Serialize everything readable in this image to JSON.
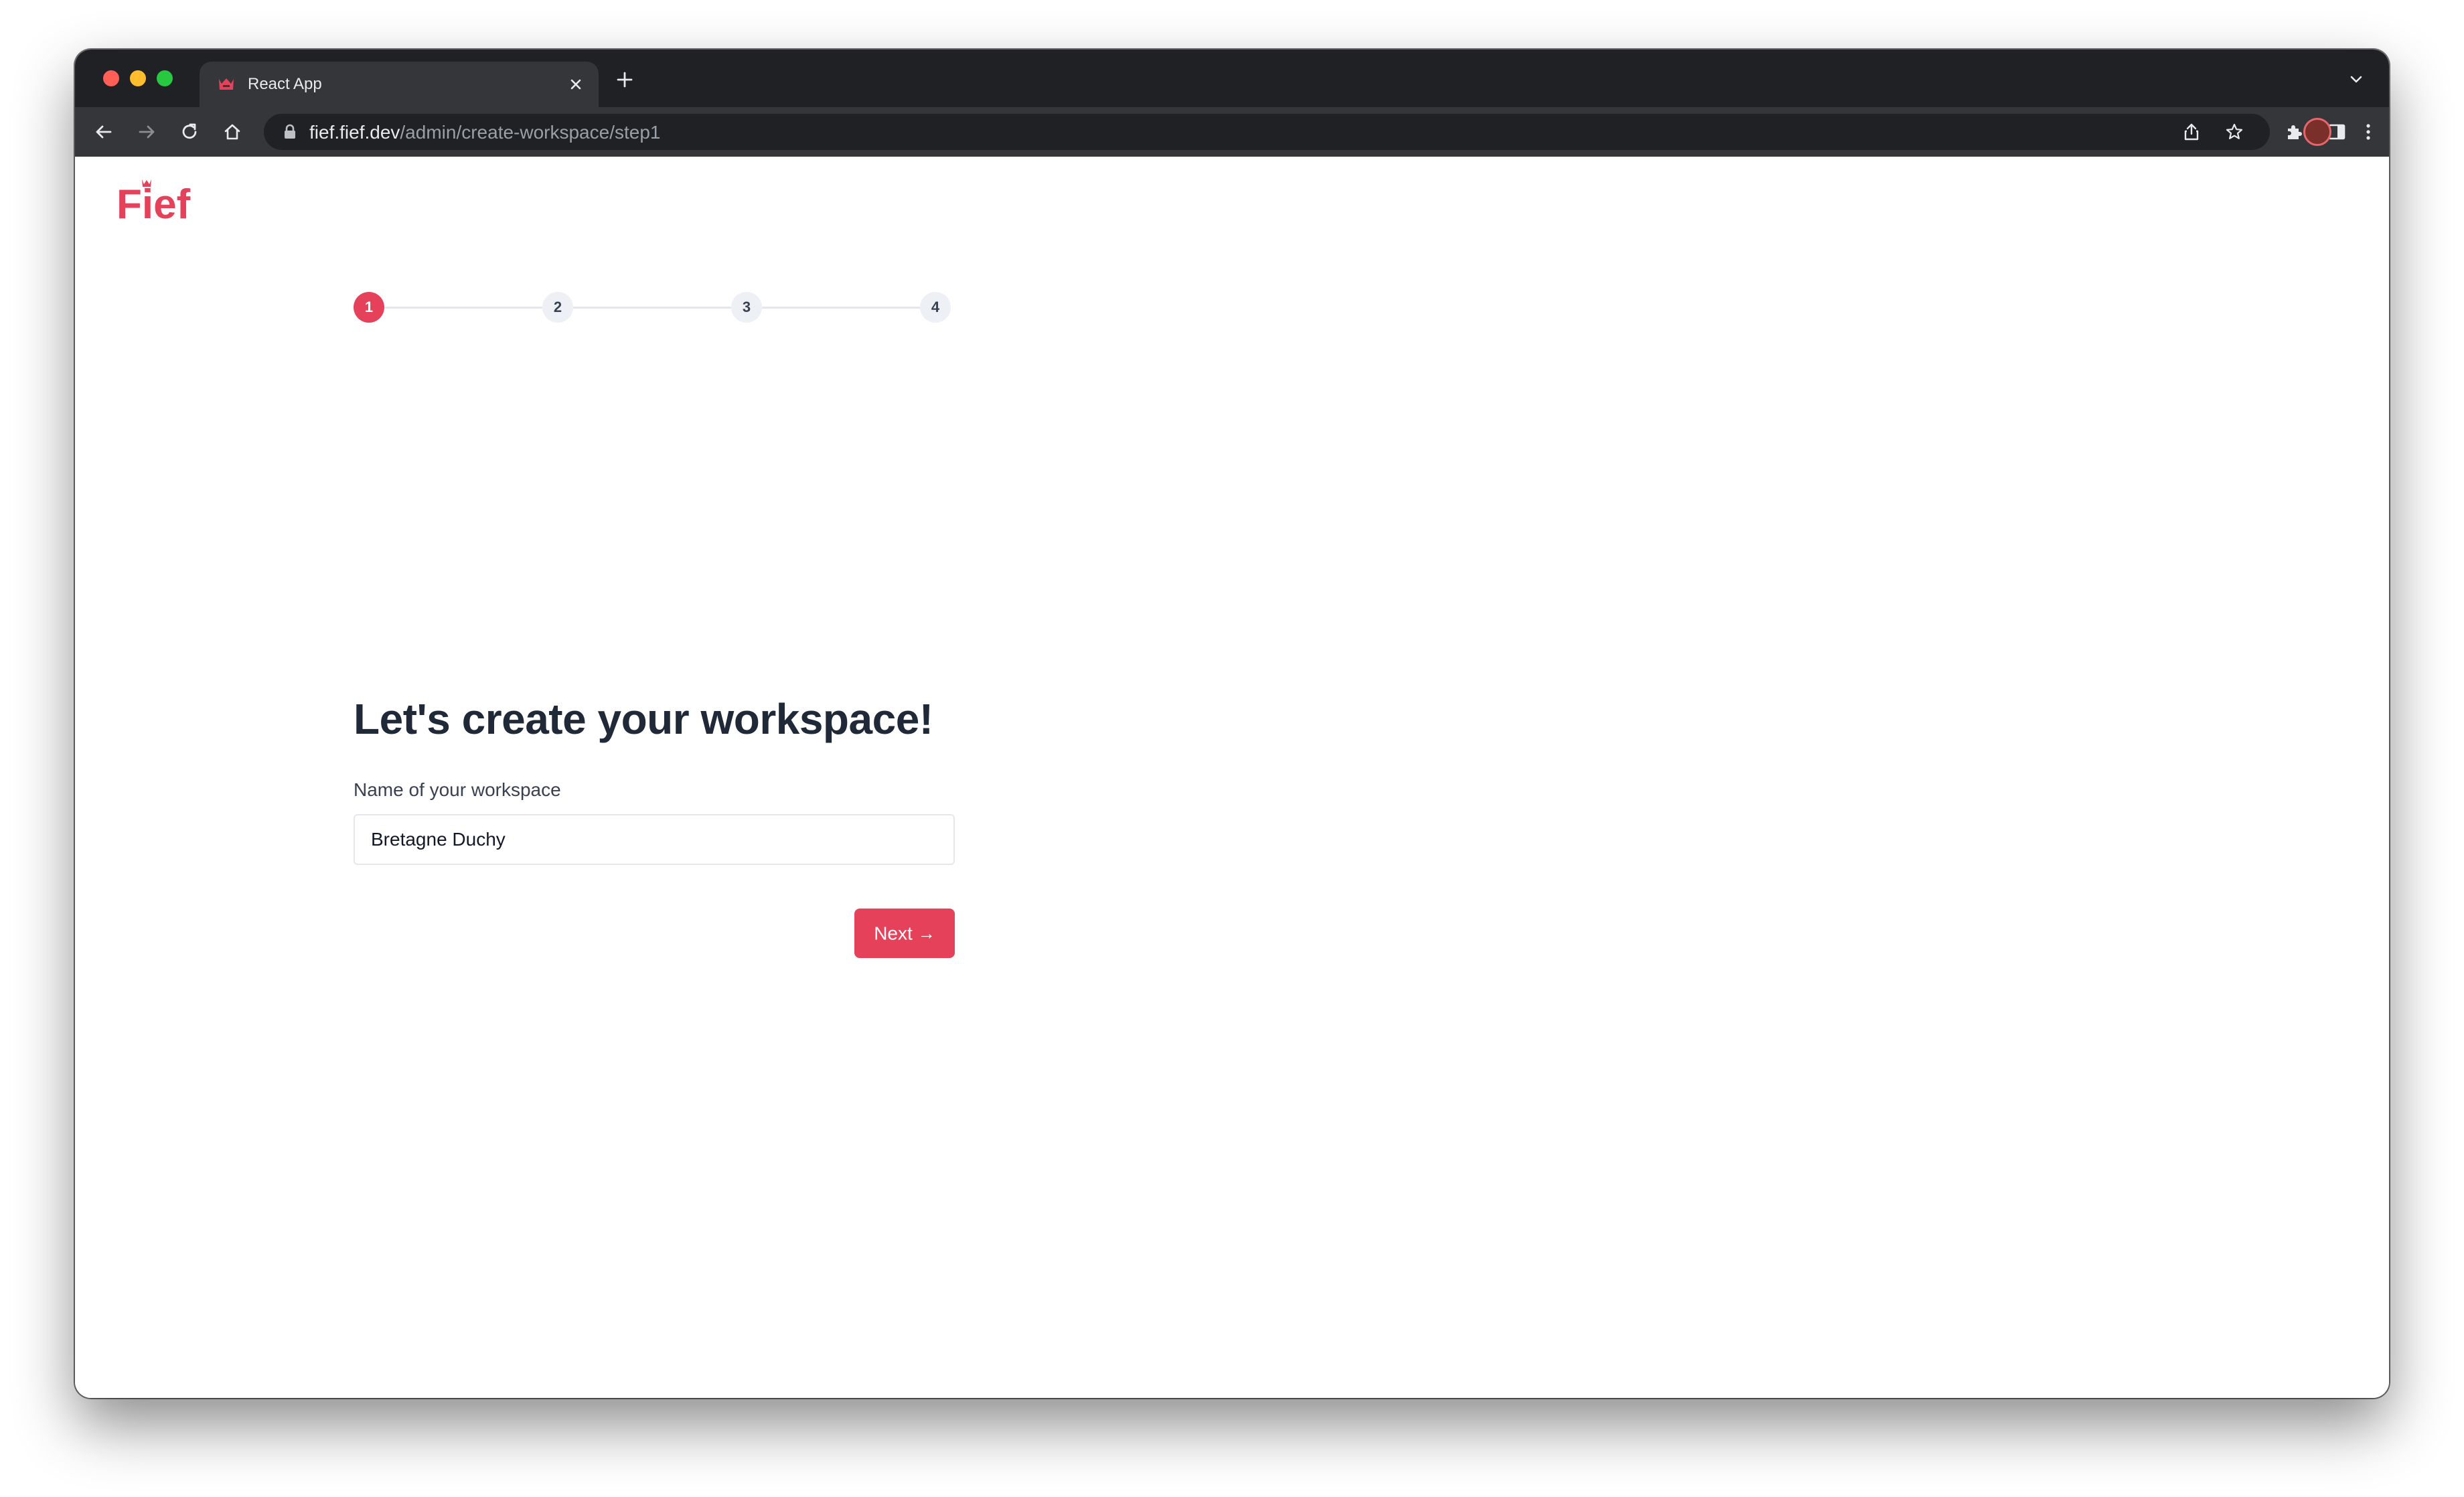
{
  "browser": {
    "tab_title": "React App",
    "url_host": "fief.fief.dev",
    "url_path": "/admin/create-workspace/step1"
  },
  "colors": {
    "brand": "#e5415b",
    "heading": "#1f2937",
    "chrome_dark": "#202124",
    "chrome_toolbar": "#35363a"
  },
  "icons": {
    "tab_favicon": "fief-crown-icon",
    "tab_close": "close-icon",
    "new_tab": "plus-icon",
    "tab_search": "chevron-down-icon",
    "back": "back-arrow-icon",
    "forward": "forward-arrow-icon",
    "reload": "reload-icon",
    "home": "home-icon",
    "lock": "lock-icon",
    "share": "share-icon",
    "bookmark": "star-icon",
    "extensions": "puzzle-icon",
    "side_panel": "side-panel-icon",
    "menu": "kebab-menu-icon"
  },
  "app": {
    "logo_text": "Fief",
    "steps": [
      {
        "label": "1",
        "active": true
      },
      {
        "label": "2",
        "active": false
      },
      {
        "label": "3",
        "active": false
      },
      {
        "label": "4",
        "active": false
      }
    ],
    "heading": "Let's create your workspace!",
    "field_label": "Name of your workspace",
    "field_value": "Bretagne Duchy",
    "next_label": "Next",
    "next_arrow": "→"
  }
}
